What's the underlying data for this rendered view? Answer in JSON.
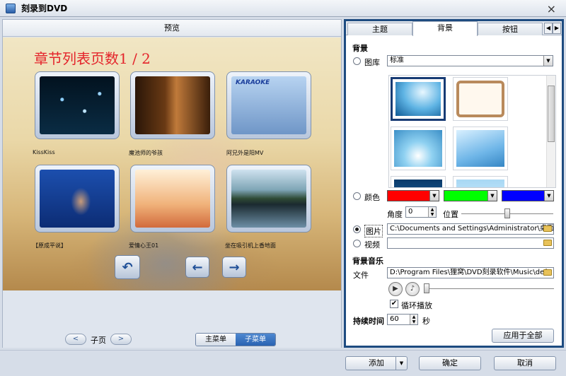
{
  "window": {
    "title": "刻录到DVD",
    "close": "×"
  },
  "preview": {
    "header": "预览",
    "chapters_title": "章节列表页数1 / 2",
    "thumbs": [
      {
        "label": "KissKiss"
      },
      {
        "label": "魔池师的爷孩"
      },
      {
        "label": "阿兄外是阳MV",
        "overlay": "KARAOKE"
      },
      {
        "label": "【原成平说】"
      },
      {
        "label": "爱情心王01"
      },
      {
        "label": "坐在吸引机上香地面"
      }
    ],
    "nav": {
      "back": "↶",
      "prev": "←",
      "next": "→"
    }
  },
  "pager": {
    "prev": "<",
    "label": "子页",
    "next": ">"
  },
  "menu_toggle": {
    "main": "主菜单",
    "sub": "子菜单",
    "selected": "子菜单"
  },
  "tabs": [
    {
      "label": "主题"
    },
    {
      "label": "背景",
      "active": true
    },
    {
      "label": "按钮"
    }
  ],
  "tab_scroll": {
    "left": "◀",
    "right": "▶"
  },
  "background": {
    "section": "背景",
    "library_label": "图库",
    "library_value": "标准",
    "color_label": "颜色",
    "colors": [
      "#ff0000",
      "#00ff00",
      "#0000ff"
    ],
    "angle_label": "角度",
    "angle_value": "0",
    "position_label": "位置",
    "position_value": 0.5,
    "picture_label": "图片",
    "picture_path": "C:\\Documents and Settings\\Administrator\\桌面",
    "video_label": "视频",
    "video_path": ""
  },
  "music": {
    "section": "背景音乐",
    "file_label": "文件",
    "file_path": "D:\\Program Files\\狸窝\\DVD刻录软件\\Music\\def",
    "loop_label": "循环播放",
    "loop_checked": true,
    "progress": 0.0
  },
  "duration": {
    "label": "持续时间",
    "value": "60",
    "unit": "秒"
  },
  "apply_all": "应用于全部",
  "footer": {
    "add": "添加",
    "ok": "确定",
    "cancel": "取消"
  }
}
